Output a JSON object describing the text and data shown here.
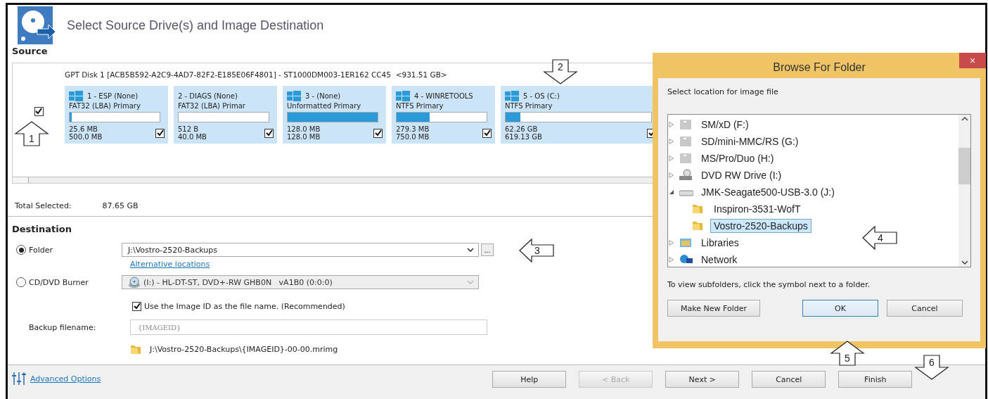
{
  "window": {
    "title": "Select Source Drive(s) and Image Destination"
  },
  "source": {
    "heading": "Source",
    "disk": {
      "label": "GPT Disk 1 [ACB5B592-A2C9-4AD7-82F2-E185E06F4801] - ST1000DM003-1ER162 CC45  <931.51 GB>",
      "checked": true
    },
    "partitions": [
      {
        "title": "1 - ESP (None)",
        "windows_logo": true,
        "type": "FAT32 (LBA) Primary",
        "level": 0.02,
        "used": "25.6 MB",
        "size": "500.0 MB",
        "checked": true
      },
      {
        "title": "2 - DIAGS (None)",
        "windows_logo": false,
        "type": "FAT32 (LBA) Primar",
        "level": 0,
        "used": "512 B",
        "size": "40.0 MB",
        "checked": true
      },
      {
        "title": "3 -  (None)",
        "windows_logo": true,
        "type": "Unformatted Primary",
        "level": 1,
        "used": "128.0 MB",
        "size": "128.0 MB",
        "checked": true
      },
      {
        "title": "4 - WINRETOOLS",
        "windows_logo": true,
        "type": "NTFS Primary",
        "level": 0.37,
        "used": "279.3 MB",
        "size": "750.0 MB",
        "checked": true
      },
      {
        "title": "5 - OS (C:)",
        "windows_logo": true,
        "type": "NTFS Primary",
        "level": 0.1,
        "used": "62.26 GB",
        "size": "619.13 GB",
        "checked": true
      }
    ]
  },
  "total": {
    "label": "Total Selected:",
    "value": "87.65 GB"
  },
  "destination": {
    "heading": "Destination",
    "options": [
      {
        "kind": "folder",
        "label": "Folder",
        "selected": true,
        "value": "J:\\Vostro-2520-Backups",
        "browse": "...",
        "link": "Alternative locations"
      },
      {
        "kind": "burner",
        "label": "CD/DVD Burner",
        "selected": false,
        "value": "(I:) - HL-DT-ST, DVD+-RW GHB0N   vA1B0 (0:0:0)",
        "disabled": true
      }
    ],
    "use_image_id": {
      "label": "Use the Image ID as the file name.  (Recommended)",
      "checked": true
    },
    "filename": {
      "label": "Backup filename:",
      "value": "{IMAGEID}",
      "disabled": true
    },
    "path": "J:\\Vostro-2520-Backups\\{IMAGEID}-00-00.mrimg"
  },
  "footer": {
    "advanced": "Advanced Options",
    "buttons": [
      {
        "label": "Help",
        "disabled": false
      },
      {
        "label": "< Back",
        "disabled": true
      },
      {
        "label": "Next >",
        "disabled": false
      },
      {
        "label": "Cancel",
        "disabled": false
      },
      {
        "label": "Finish",
        "disabled": false
      }
    ]
  },
  "dialog": {
    "title": "Browse For Folder",
    "close": "×",
    "prompt": "Select location for image file",
    "tree": [
      {
        "label": "SM/xD (F:)",
        "kind": "card",
        "expanded": false,
        "selected": false
      },
      {
        "label": "SD/mini-MMC/RS (G:)",
        "kind": "card",
        "expanded": false,
        "selected": false
      },
      {
        "label": "MS/Pro/Duo (H:)",
        "kind": "card",
        "expanded": false,
        "selected": false
      },
      {
        "label": "DVD RW Drive (I:)",
        "kind": "dvd",
        "expanded": false,
        "selected": false
      },
      {
        "label": "JMK-Seagate500-USB-3.0 (J:)",
        "kind": "drive",
        "expanded": true,
        "selected": false,
        "children": [
          {
            "label": "Inspiron-3531-WofT",
            "kind": "folder",
            "selected": false
          },
          {
            "label": "Vostro-2520-Backups",
            "kind": "folder",
            "selected": true
          }
        ]
      },
      {
        "label": "Libraries",
        "kind": "libraries",
        "expanded": false,
        "selected": false
      },
      {
        "label": "Network",
        "kind": "network",
        "expanded": false,
        "selected": false
      }
    ],
    "hint": "To view subfolders, click the symbol next to a folder.",
    "buttons": [
      {
        "label": "Make New Folder",
        "focused": false
      },
      {
        "label": "OK",
        "focused": true
      },
      {
        "label": "Cancel",
        "focused": false
      }
    ]
  },
  "callouts": [
    {
      "number": "1",
      "kind": "up"
    },
    {
      "number": "2",
      "kind": "down"
    },
    {
      "number": "3",
      "kind": "left"
    },
    {
      "number": "4",
      "kind": "left"
    },
    {
      "number": "5",
      "kind": "up"
    },
    {
      "number": "6",
      "kind": "down"
    }
  ]
}
